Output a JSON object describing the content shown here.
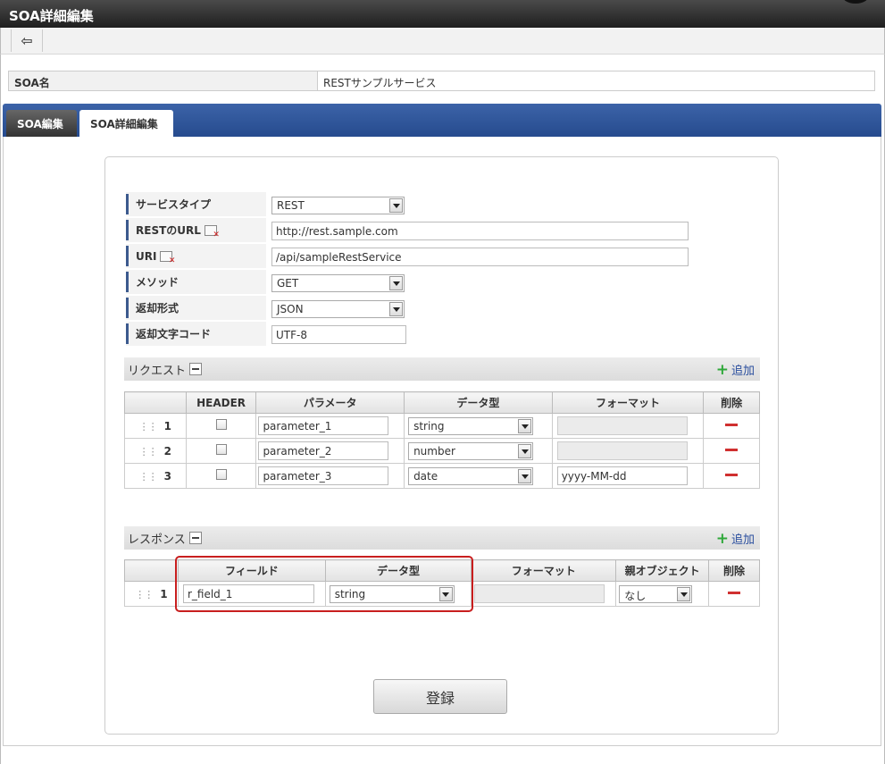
{
  "title": "SOA詳細編集",
  "soa_name": {
    "label": "SOA名",
    "value": "RESTサンプルサービス"
  },
  "tabs": [
    {
      "label": "SOA編集",
      "active": false
    },
    {
      "label": "SOA詳細編集",
      "active": true
    }
  ],
  "props": {
    "service_type": {
      "label": "サービスタイプ",
      "value": "REST"
    },
    "rest_url": {
      "label": "RESTのURL",
      "value": "http://rest.sample.com"
    },
    "uri": {
      "label": "URI",
      "value": "/api/sampleRestService"
    },
    "method": {
      "label": "メソッド",
      "value": "GET"
    },
    "return_format": {
      "label": "返却形式",
      "value": "JSON"
    },
    "return_charset": {
      "label": "返却文字コード",
      "value": "UTF-8"
    }
  },
  "request": {
    "title": "リクエスト",
    "add_label": "追加",
    "headers": [
      "HEADER",
      "パラメータ",
      "データ型",
      "フォーマット",
      "削除"
    ],
    "rows": [
      {
        "num": "1",
        "param": "parameter_1",
        "type": "string",
        "format": ""
      },
      {
        "num": "2",
        "param": "parameter_2",
        "type": "number",
        "format": ""
      },
      {
        "num": "3",
        "param": "parameter_3",
        "type": "date",
        "format": "yyyy-MM-dd"
      }
    ]
  },
  "response": {
    "title": "レスポンス",
    "add_label": "追加",
    "headers": [
      "フィールド",
      "データ型",
      "フォーマット",
      "親オブジェクト",
      "削除"
    ],
    "rows": [
      {
        "num": "1",
        "field": "r_field_1",
        "type": "string",
        "format": "",
        "parent": "なし"
      }
    ]
  },
  "submit_label": "登録"
}
